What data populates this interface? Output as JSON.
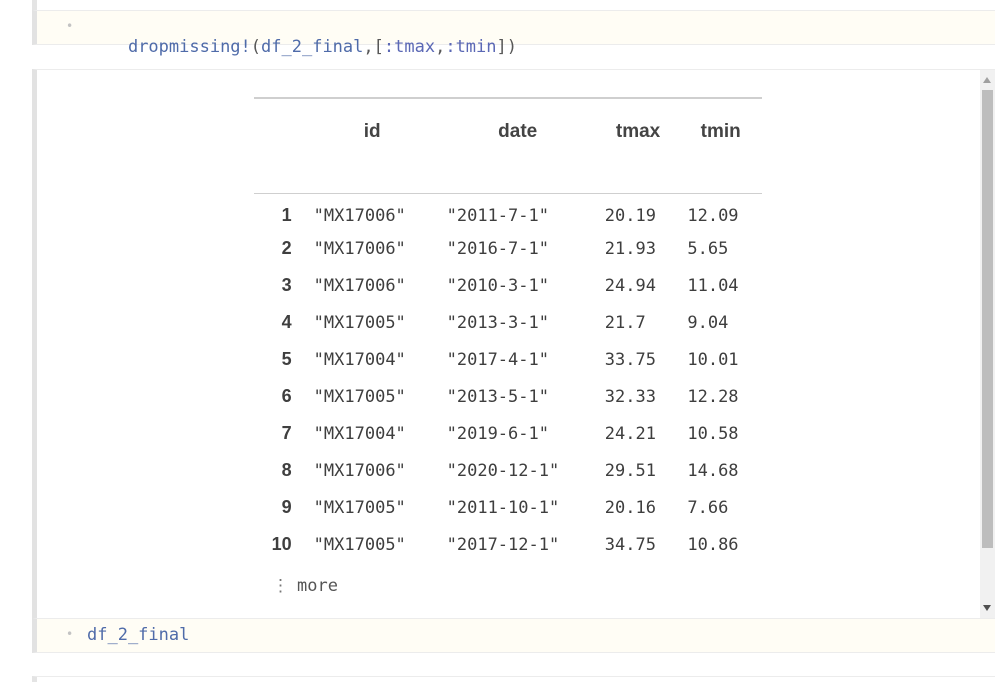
{
  "cells": {
    "cell1": {
      "bullet": "•",
      "fn": "dropmissing!",
      "open_paren": "(",
      "arg": "df_2_final",
      "comma1": ",",
      "open_bracket": "[",
      "sym1": ":tmax",
      "comma2": ",",
      "sym2": ":tmin",
      "close": "])"
    },
    "cell2": {
      "bullet": "•",
      "code": "df_2_final"
    }
  },
  "table": {
    "columns": [
      "",
      "id",
      "date",
      "tmax",
      "tmin"
    ],
    "rows": [
      [
        "1",
        "\"MX17006\"",
        "\"2011-7-1\"",
        "20.19",
        "12.09"
      ],
      [
        "2",
        "\"MX17006\"",
        "\"2016-7-1\"",
        "21.93",
        "5.65"
      ],
      [
        "3",
        "\"MX17006\"",
        "\"2010-3-1\"",
        "24.94",
        "11.04"
      ],
      [
        "4",
        "\"MX17005\"",
        "\"2013-3-1\"",
        "21.7",
        "9.04"
      ],
      [
        "5",
        "\"MX17004\"",
        "\"2017-4-1\"",
        "33.75",
        "10.01"
      ],
      [
        "6",
        "\"MX17005\"",
        "\"2013-5-1\"",
        "32.33",
        "12.28"
      ],
      [
        "7",
        "\"MX17004\"",
        "\"2019-6-1\"",
        "24.21",
        "10.58"
      ],
      [
        "8",
        "\"MX17006\"",
        "\"2020-12-1\"",
        "29.51",
        "14.68"
      ],
      [
        "9",
        "\"MX17005\"",
        "\"2011-10-1\"",
        "20.16",
        "7.66"
      ],
      [
        "10",
        "\"MX17005\"",
        "\"2017-12-1\"",
        "34.75",
        "10.86"
      ]
    ],
    "more_icon": "⋮",
    "more_label": "more"
  }
}
